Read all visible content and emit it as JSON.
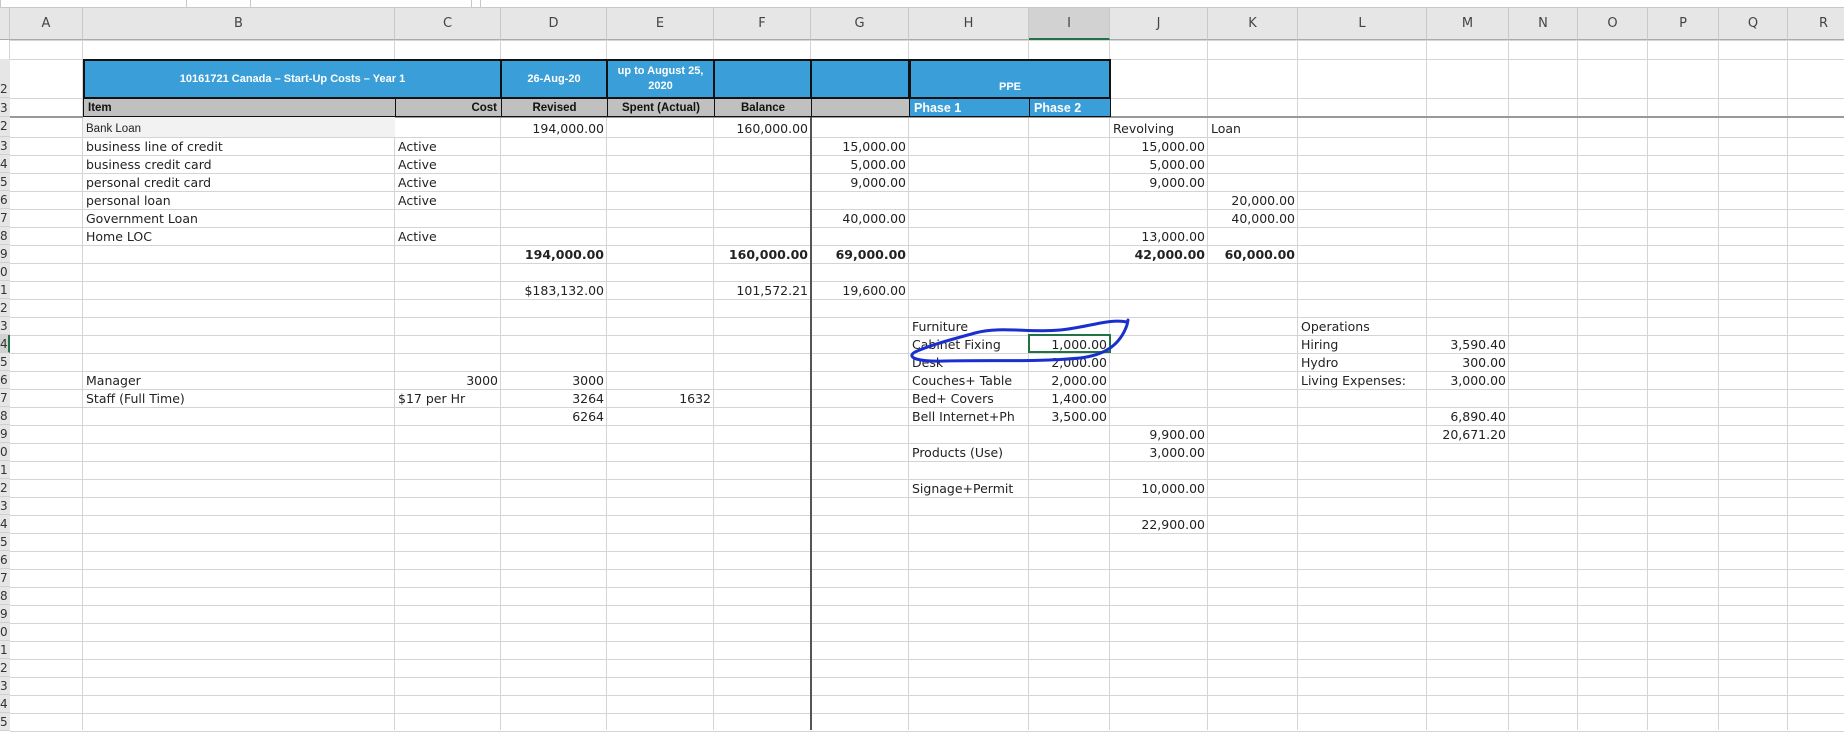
{
  "columns": [
    "A",
    "B",
    "C",
    "D",
    "E",
    "F",
    "G",
    "H",
    "I",
    "J",
    "K",
    "L",
    "M",
    "N",
    "O",
    "P",
    "Q",
    "R"
  ],
  "selected_column": "I",
  "header_rows": {
    "row_labels": [
      "2",
      "3"
    ]
  },
  "row_labels": [
    "2",
    "3",
    "4",
    "5",
    "6",
    "7",
    "8",
    "9",
    "0",
    "1",
    "2",
    "3",
    "4",
    "5",
    "6",
    "7",
    "8",
    "9",
    "0",
    "1",
    "2",
    "3",
    "4",
    "5",
    "6",
    "7",
    "8",
    "9",
    "0",
    "1",
    "2",
    "3",
    "4",
    "5"
  ],
  "selected_row_index": 12,
  "table_header": {
    "title": "10161721 Canada – Start-Up Costs – Year 1",
    "date": "26-Aug-20",
    "period": "up to August 25, 2020",
    "ppe": "PPE",
    "item": "Item",
    "cost": "Cost",
    "revised": "Revised",
    "spent": "Spent (Actual)",
    "balance": "Balance",
    "phase1": "Phase 1",
    "phase2": "Phase 2"
  },
  "cells": [
    {
      "r": 0,
      "c": "B",
      "v": "Bank Loan"
    },
    {
      "r": 0,
      "c": "D",
      "v": "194,000.00"
    },
    {
      "r": 0,
      "c": "F",
      "v": "160,000.00"
    },
    {
      "r": 0,
      "c": "J",
      "v": "Revolving"
    },
    {
      "r": 0,
      "c": "K",
      "v": "Loan"
    },
    {
      "r": 1,
      "c": "B",
      "v": "business line of credit"
    },
    {
      "r": 1,
      "c": "C",
      "v": "Active"
    },
    {
      "r": 1,
      "c": "G",
      "v": "15,000.00"
    },
    {
      "r": 1,
      "c": "J",
      "v": "15,000.00"
    },
    {
      "r": 2,
      "c": "B",
      "v": "business credit card"
    },
    {
      "r": 2,
      "c": "C",
      "v": "Active"
    },
    {
      "r": 2,
      "c": "G",
      "v": "5,000.00"
    },
    {
      "r": 2,
      "c": "J",
      "v": "5,000.00"
    },
    {
      "r": 3,
      "c": "B",
      "v": "personal credit card"
    },
    {
      "r": 3,
      "c": "C",
      "v": "Active"
    },
    {
      "r": 3,
      "c": "G",
      "v": "9,000.00"
    },
    {
      "r": 3,
      "c": "J",
      "v": "9,000.00"
    },
    {
      "r": 4,
      "c": "B",
      "v": "personal loan"
    },
    {
      "r": 4,
      "c": "C",
      "v": "Active"
    },
    {
      "r": 4,
      "c": "K",
      "v": "20,000.00"
    },
    {
      "r": 5,
      "c": "B",
      "v": "Government Loan"
    },
    {
      "r": 5,
      "c": "G",
      "v": "40,000.00"
    },
    {
      "r": 5,
      "c": "K",
      "v": "40,000.00"
    },
    {
      "r": 6,
      "c": "B",
      "v": "Home LOC"
    },
    {
      "r": 6,
      "c": "C",
      "v": "Active"
    },
    {
      "r": 6,
      "c": "J",
      "v": "13,000.00"
    },
    {
      "r": 7,
      "c": "D",
      "v": "194,000.00"
    },
    {
      "r": 7,
      "c": "F",
      "v": "160,000.00"
    },
    {
      "r": 7,
      "c": "G",
      "v": "69,000.00"
    },
    {
      "r": 7,
      "c": "J",
      "v": "42,000.00"
    },
    {
      "r": 7,
      "c": "K",
      "v": "60,000.00"
    },
    {
      "r": 9,
      "c": "D",
      "v": "$183,132.00"
    },
    {
      "r": 9,
      "c": "F",
      "v": "101,572.21"
    },
    {
      "r": 9,
      "c": "G",
      "v": "19,600.00"
    },
    {
      "r": 11,
      "c": "H",
      "v": "Furniture"
    },
    {
      "r": 11,
      "c": "L",
      "v": "Operations"
    },
    {
      "r": 12,
      "c": "H",
      "v": "Cabinet Fixing"
    },
    {
      "r": 12,
      "c": "I",
      "v": "1,000.00"
    },
    {
      "r": 12,
      "c": "L",
      "v": "Hiring"
    },
    {
      "r": 12,
      "c": "M",
      "v": "3,590.40"
    },
    {
      "r": 13,
      "c": "H",
      "v": "Desk"
    },
    {
      "r": 13,
      "c": "I",
      "v": "2,000.00"
    },
    {
      "r": 13,
      "c": "L",
      "v": "Hydro"
    },
    {
      "r": 13,
      "c": "M",
      "v": "300.00"
    },
    {
      "r": 14,
      "c": "B",
      "v": "Manager"
    },
    {
      "r": 14,
      "c": "C",
      "v": "3000"
    },
    {
      "r": 14,
      "c": "D",
      "v": "3000"
    },
    {
      "r": 14,
      "c": "H",
      "v": "Couches+ Table"
    },
    {
      "r": 14,
      "c": "I",
      "v": "2,000.00"
    },
    {
      "r": 14,
      "c": "L",
      "v": "Living Expenses:"
    },
    {
      "r": 14,
      "c": "M",
      "v": "3,000.00"
    },
    {
      "r": 15,
      "c": "B",
      "v": "Staff (Full Time)"
    },
    {
      "r": 15,
      "c": "C",
      "v": "$17 per Hr"
    },
    {
      "r": 15,
      "c": "D",
      "v": "3264"
    },
    {
      "r": 15,
      "c": "E",
      "v": "1632"
    },
    {
      "r": 15,
      "c": "H",
      "v": "Bed+ Covers"
    },
    {
      "r": 15,
      "c": "I",
      "v": "1,400.00"
    },
    {
      "r": 16,
      "c": "D",
      "v": "6264"
    },
    {
      "r": 16,
      "c": "H",
      "v": "Bell Internet+Ph"
    },
    {
      "r": 16,
      "c": "I",
      "v": "3,500.00"
    },
    {
      "r": 16,
      "c": "M",
      "v": "6,890.40"
    },
    {
      "r": 17,
      "c": "J",
      "v": "9,900.00"
    },
    {
      "r": 17,
      "c": "M",
      "v": "20,671.20"
    },
    {
      "r": 18,
      "c": "H",
      "v": "Products (Use)"
    },
    {
      "r": 18,
      "c": "J",
      "v": "3,000.00"
    },
    {
      "r": 20,
      "c": "H",
      "v": "Signage+Permit"
    },
    {
      "r": 20,
      "c": "J",
      "v": "10,000.00"
    },
    {
      "r": 22,
      "c": "J",
      "v": "22,900.00"
    }
  ],
  "colors": {
    "header_blue": "#3a9fd8",
    "header_gray": "#c0c0c0",
    "selection_green": "#217346",
    "annotation_blue": "#1a2fd0"
  }
}
